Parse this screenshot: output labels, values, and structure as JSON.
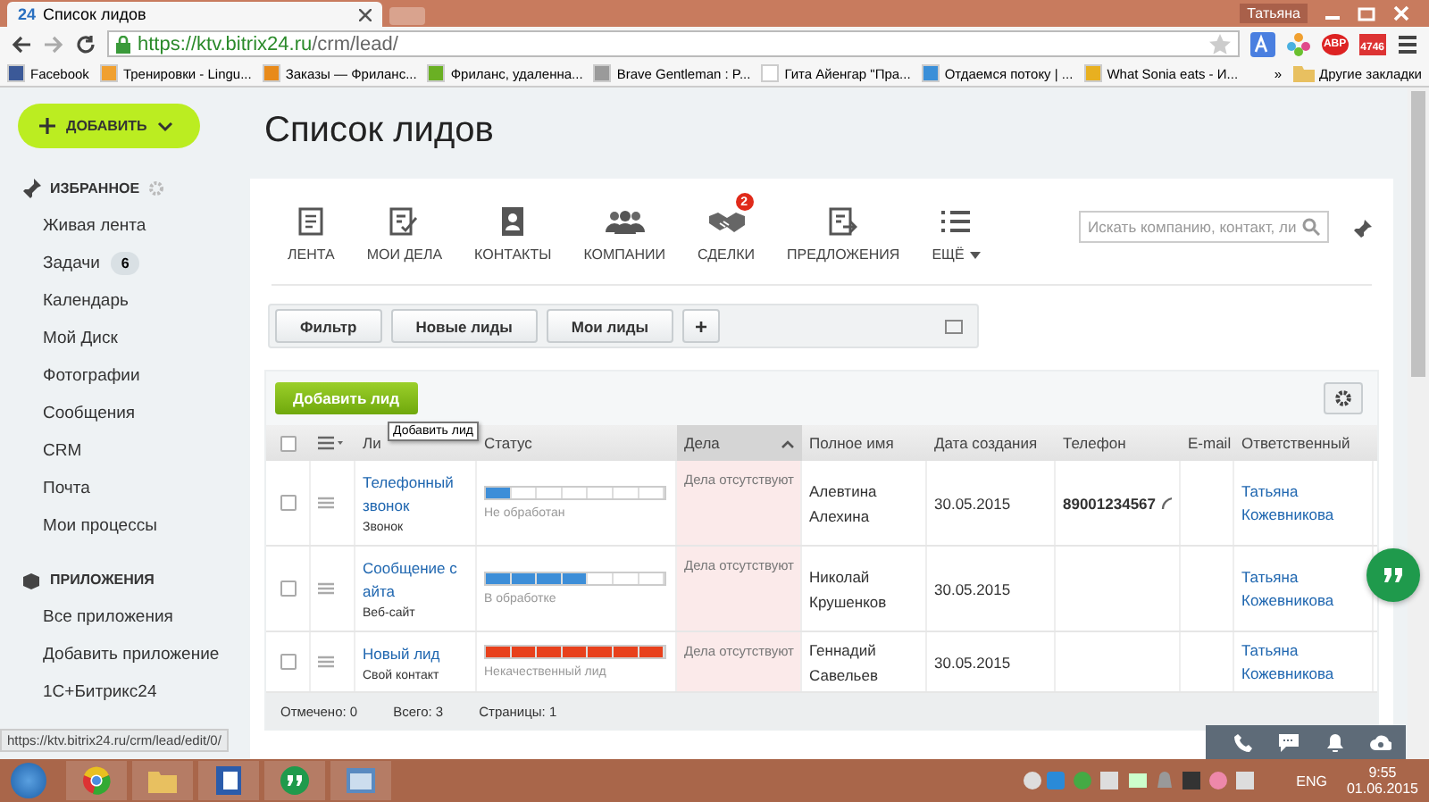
{
  "browser": {
    "tab_icon": "24",
    "tab_title": "Список лидов",
    "user": "Татьяна",
    "url_host": "https://ktv.bitrix24.ru",
    "url_path": "/crm/lead/",
    "adblock_label": "ABP",
    "mail_count": "4746",
    "bookmarks": [
      {
        "label": "Facebook",
        "color": "#3b5998"
      },
      {
        "label": "Тренировки - Lingu...",
        "color": "#f0a030"
      },
      {
        "label": "Заказы — Фриланс...",
        "color": "#e88a1a"
      },
      {
        "label": "Фриланс, удаленна...",
        "color": "#6ab023"
      },
      {
        "label": "Brave Gentleman : P...",
        "color": "#9a9a9a"
      },
      {
        "label": "Гита Айенгар \"Пра...",
        "color": "#ffffff"
      },
      {
        "label": "Отдаемся потоку | ...",
        "color": "#3a8fd8"
      },
      {
        "label": "What Sonia eats - И...",
        "color": "#e8b020"
      }
    ],
    "bookmarks_more": "»",
    "other_bookmarks": "Другие закладки"
  },
  "sidebar": {
    "add_button": "ДОБАВИТЬ",
    "favorites_title": "ИЗБРАННОЕ",
    "favorites": [
      {
        "label": "Живая лента"
      },
      {
        "label": "Задачи",
        "badge": "6"
      },
      {
        "label": "Календарь"
      },
      {
        "label": "Мой Диск"
      },
      {
        "label": "Фотографии"
      },
      {
        "label": "Сообщения"
      },
      {
        "label": "CRM"
      },
      {
        "label": "Почта"
      },
      {
        "label": "Мои процессы"
      }
    ],
    "apps_title": "ПРИЛОЖЕНИЯ",
    "apps": [
      {
        "label": "Все приложения"
      },
      {
        "label": "Добавить приложение"
      },
      {
        "label": "1С+Битрикс24"
      }
    ]
  },
  "page_title": "Список лидов",
  "toolbar": [
    {
      "kind": "feed",
      "label": "ЛЕНТА"
    },
    {
      "kind": "tasks",
      "label": "МОИ ДЕЛА"
    },
    {
      "kind": "contacts",
      "label": "КОНТАКТЫ"
    },
    {
      "kind": "companies",
      "label": "КОМПАНИИ"
    },
    {
      "kind": "deals",
      "label": "СДЕЛКИ",
      "badge": "2"
    },
    {
      "kind": "offers",
      "label": "ПРЕДЛОЖЕНИЯ"
    },
    {
      "kind": "more",
      "label": "ЕЩЁ"
    }
  ],
  "search": {
    "placeholder": "Искать компанию, контакт, ли"
  },
  "filters": [
    "Фильтр",
    "Новые лиды",
    "Мои лиды"
  ],
  "add_filter": "+",
  "add_lead_button": "Добавить лид",
  "tooltip": "Добавить лид",
  "table": {
    "select_all_checked": false,
    "columns": [
      {
        "label": "Ли",
        "sorted": false
      },
      {
        "label": "Статус",
        "sorted": false
      },
      {
        "label": "Дела",
        "sorted": true
      },
      {
        "label": "Полное имя",
        "sorted": false
      },
      {
        "label": "Дата создания",
        "sorted": false
      },
      {
        "label": "Телефон",
        "sorted": false
      },
      {
        "label": "E-mail",
        "sorted": false
      },
      {
        "label": "Ответственный",
        "sorted": false
      }
    ],
    "rows": [
      {
        "checked": false,
        "lead": "Телефонный звонок",
        "source": "Звонок",
        "level": 0.14,
        "color": "#3d8ed8",
        "status": "Не обработан",
        "deals": "Дела отсутствуют",
        "full_name": "Алевтина Алехина",
        "created": "30.05.2015",
        "phone": "89001234567",
        "responsible": "Татьяна Кожевникова"
      },
      {
        "checked": false,
        "lead": "Сообщение с айта",
        "source": "Веб-сайт",
        "level": 0.57,
        "color": "#3d8ed8",
        "status": "В обработке",
        "deals": "Дела отсутствуют",
        "full_name": "Николай Крушенков",
        "created": "30.05.2015",
        "responsible": "Татьяна Кожевникова"
      },
      {
        "checked": false,
        "lead": "Новый лид",
        "source": "Свой контакт",
        "level": 1,
        "color": "#e8411c",
        "status": "Некачественный лид",
        "deals": "Дела отсутствуют",
        "full_name": "Геннадий Савельев",
        "created": "30.05.2015",
        "responsible": "Татьяна Кожевникова"
      }
    ],
    "footer": [
      "Отмечено: 0",
      "Всего: 3",
      "Страницы:  1"
    ]
  },
  "status_url": "https://ktv.bitrix24.ru/crm/lead/edit/0/",
  "taskbar": {
    "language": "ENG",
    "time": "9:55",
    "date": "01.06.2015"
  }
}
